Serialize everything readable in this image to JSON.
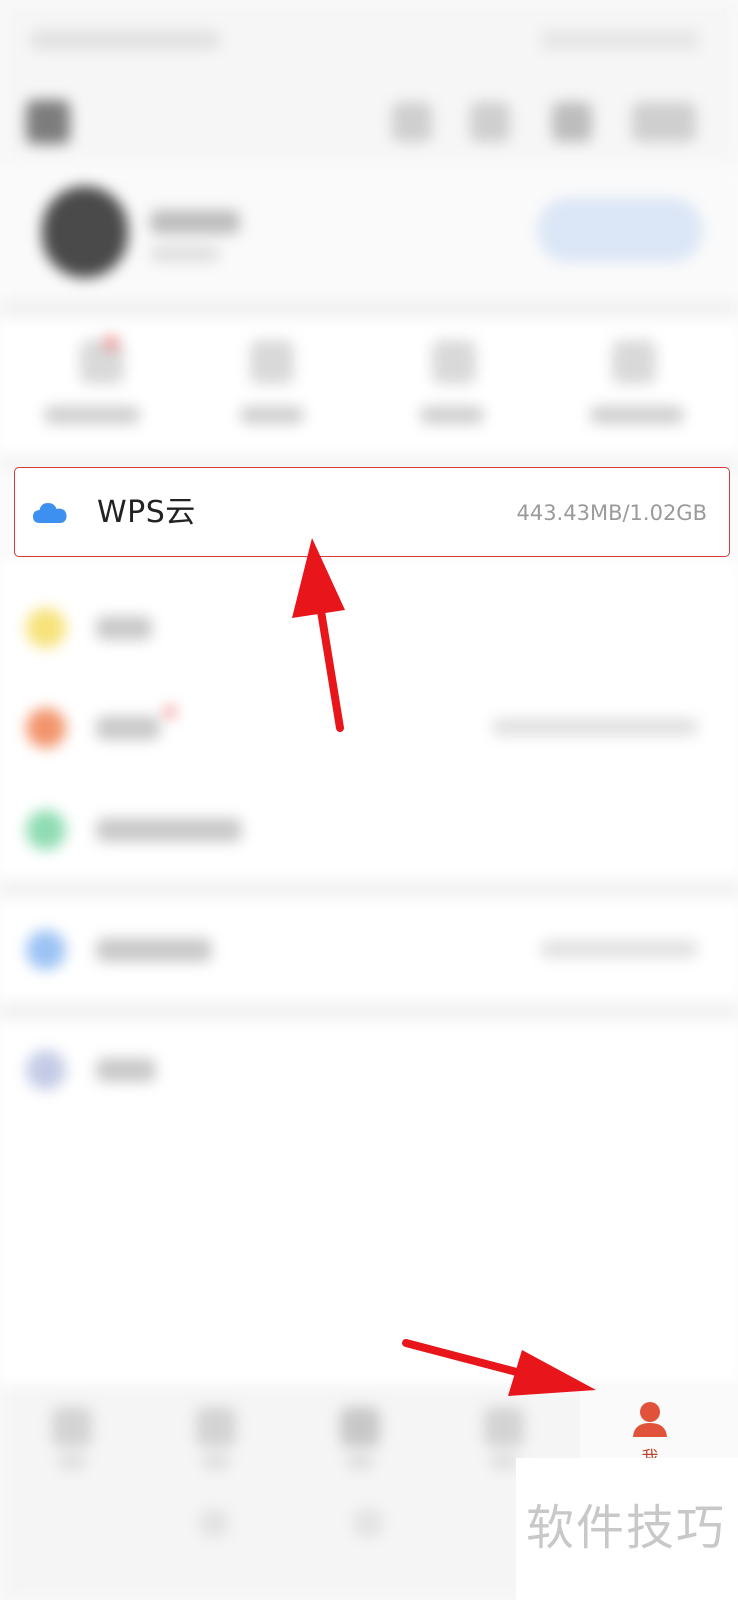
{
  "wps_cloud": {
    "title": "WPS云",
    "usage": "443.43MB/1.02GB",
    "icon": "cloud-icon",
    "accent_color": "#3d8ff0",
    "highlight_color": "#d9393b"
  },
  "tabbar": {
    "me_label": "我",
    "me_icon": "user-icon",
    "active_color": "#e0533a"
  },
  "watermark": {
    "text": "软件技巧"
  },
  "annotation": {
    "arrow_color": "#e8151b"
  }
}
